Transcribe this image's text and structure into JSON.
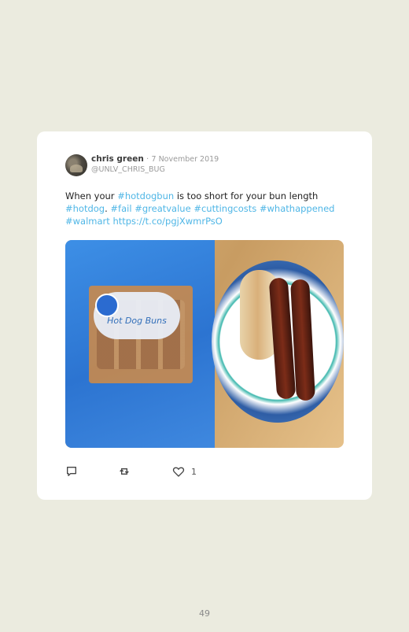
{
  "tweet": {
    "author_name": "chris green",
    "separator": "·",
    "date": "7 November 2019",
    "handle": "@UNLV_CHRIS_BUG",
    "text": {
      "lead": "When your ",
      "tag1": "#hotdogbun",
      "middle": " is too short for your bun length",
      "tag2": "#hotdog",
      "comma": ". ",
      "tag3": "#fail",
      "tag4": "#greatvalue",
      "tag5": "#cuttingcosts",
      "tag6": "#whathappened",
      "tag7": "#walmart",
      "link": "https://t.co/pgjXwmrPsO"
    },
    "photo": {
      "alt": "",
      "bag_label": "Hot Dog Buns"
    },
    "actions": {
      "like_count": "1"
    }
  },
  "icons": {
    "reply": "reply-icon",
    "retweet": "retweet-icon",
    "like": "heart-icon"
  },
  "colors": {
    "background": "#ebebdf",
    "card": "#ffffff",
    "accent": "#4fb6e6"
  },
  "page": {
    "number": "49"
  }
}
